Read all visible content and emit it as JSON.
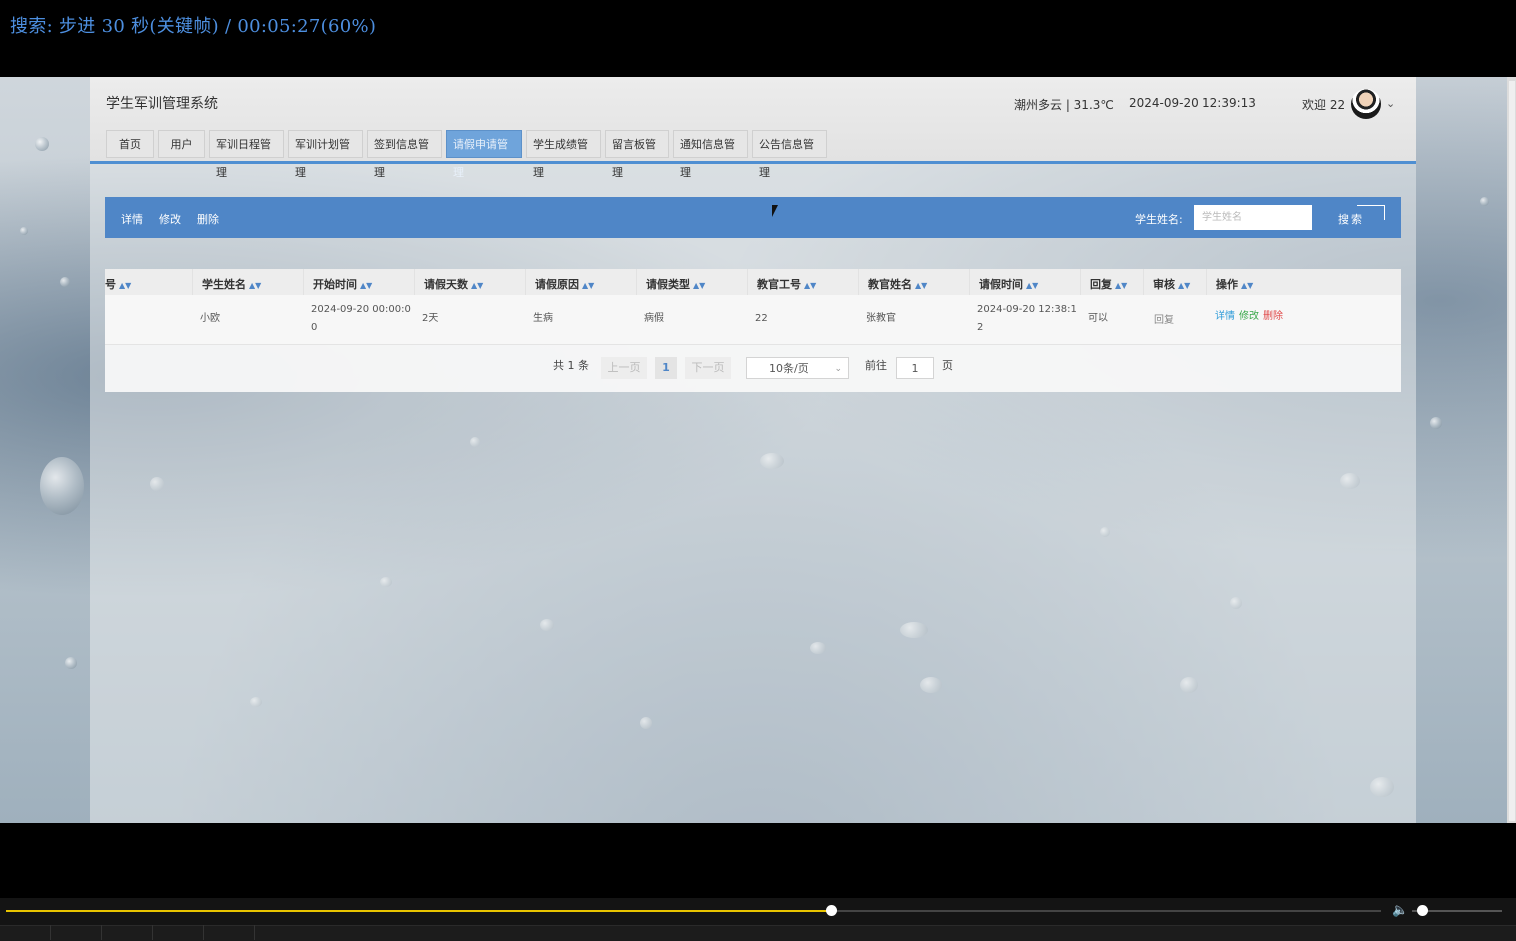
{
  "player": {
    "osd_text": "搜索: 步进 30 秒(关键帧) / 00:05:27(60%)",
    "progress_percent": 60
  },
  "app": {
    "title": "学生军训管理系统",
    "weather": "潮州多云 | 31.3℃",
    "date": "2024-09-20",
    "time": "12:39:13",
    "welcome": "欢迎 22",
    "nav": [
      "首页",
      "用户",
      "军训日程管理",
      "军训计划管理",
      "签到信息管理",
      "请假申请管理",
      "学生成绩管理",
      "留言板管理",
      "通知信息管理",
      "公告信息管理"
    ],
    "active_nav": "请假申请管理"
  },
  "toolbar": {
    "detail": "详情",
    "edit": "修改",
    "delete": "删除",
    "search_label": "学生姓名:",
    "search_placeholder": "学生姓名",
    "search_button": "搜索"
  },
  "table": {
    "headers": [
      "号",
      "学生姓名",
      "开始时间",
      "请假天数",
      "请假原因",
      "请假类型",
      "教官工号",
      "教官姓名",
      "请假时间",
      "回复",
      "审核",
      "操作"
    ],
    "row": {
      "student_name": "小欧",
      "start_time_line1": "2024-09-20 00:00:0",
      "start_time_line2": "0",
      "days": "2天",
      "reason": "生病",
      "type": "病假",
      "instructor_id": "22",
      "instructor_name": "张教官",
      "leave_time_line1": "2024-09-20 12:38:1",
      "leave_time_line2": "2",
      "reply": "可以",
      "review": "回复",
      "op_detail": "详情",
      "op_edit": "修改",
      "op_delete": "删除"
    }
  },
  "pagination": {
    "total": "共 1 条",
    "prev": "上一页",
    "page": "1",
    "next": "下一页",
    "page_size": "10条/页",
    "goto_label": "前往",
    "goto_value": "1",
    "page_suffix": "页"
  },
  "colors": {
    "accent": "#4f86c7",
    "seek": "#e8c400",
    "op_detail": "#2e9bd8",
    "op_edit": "#3aa84a",
    "op_delete": "#e04848"
  }
}
